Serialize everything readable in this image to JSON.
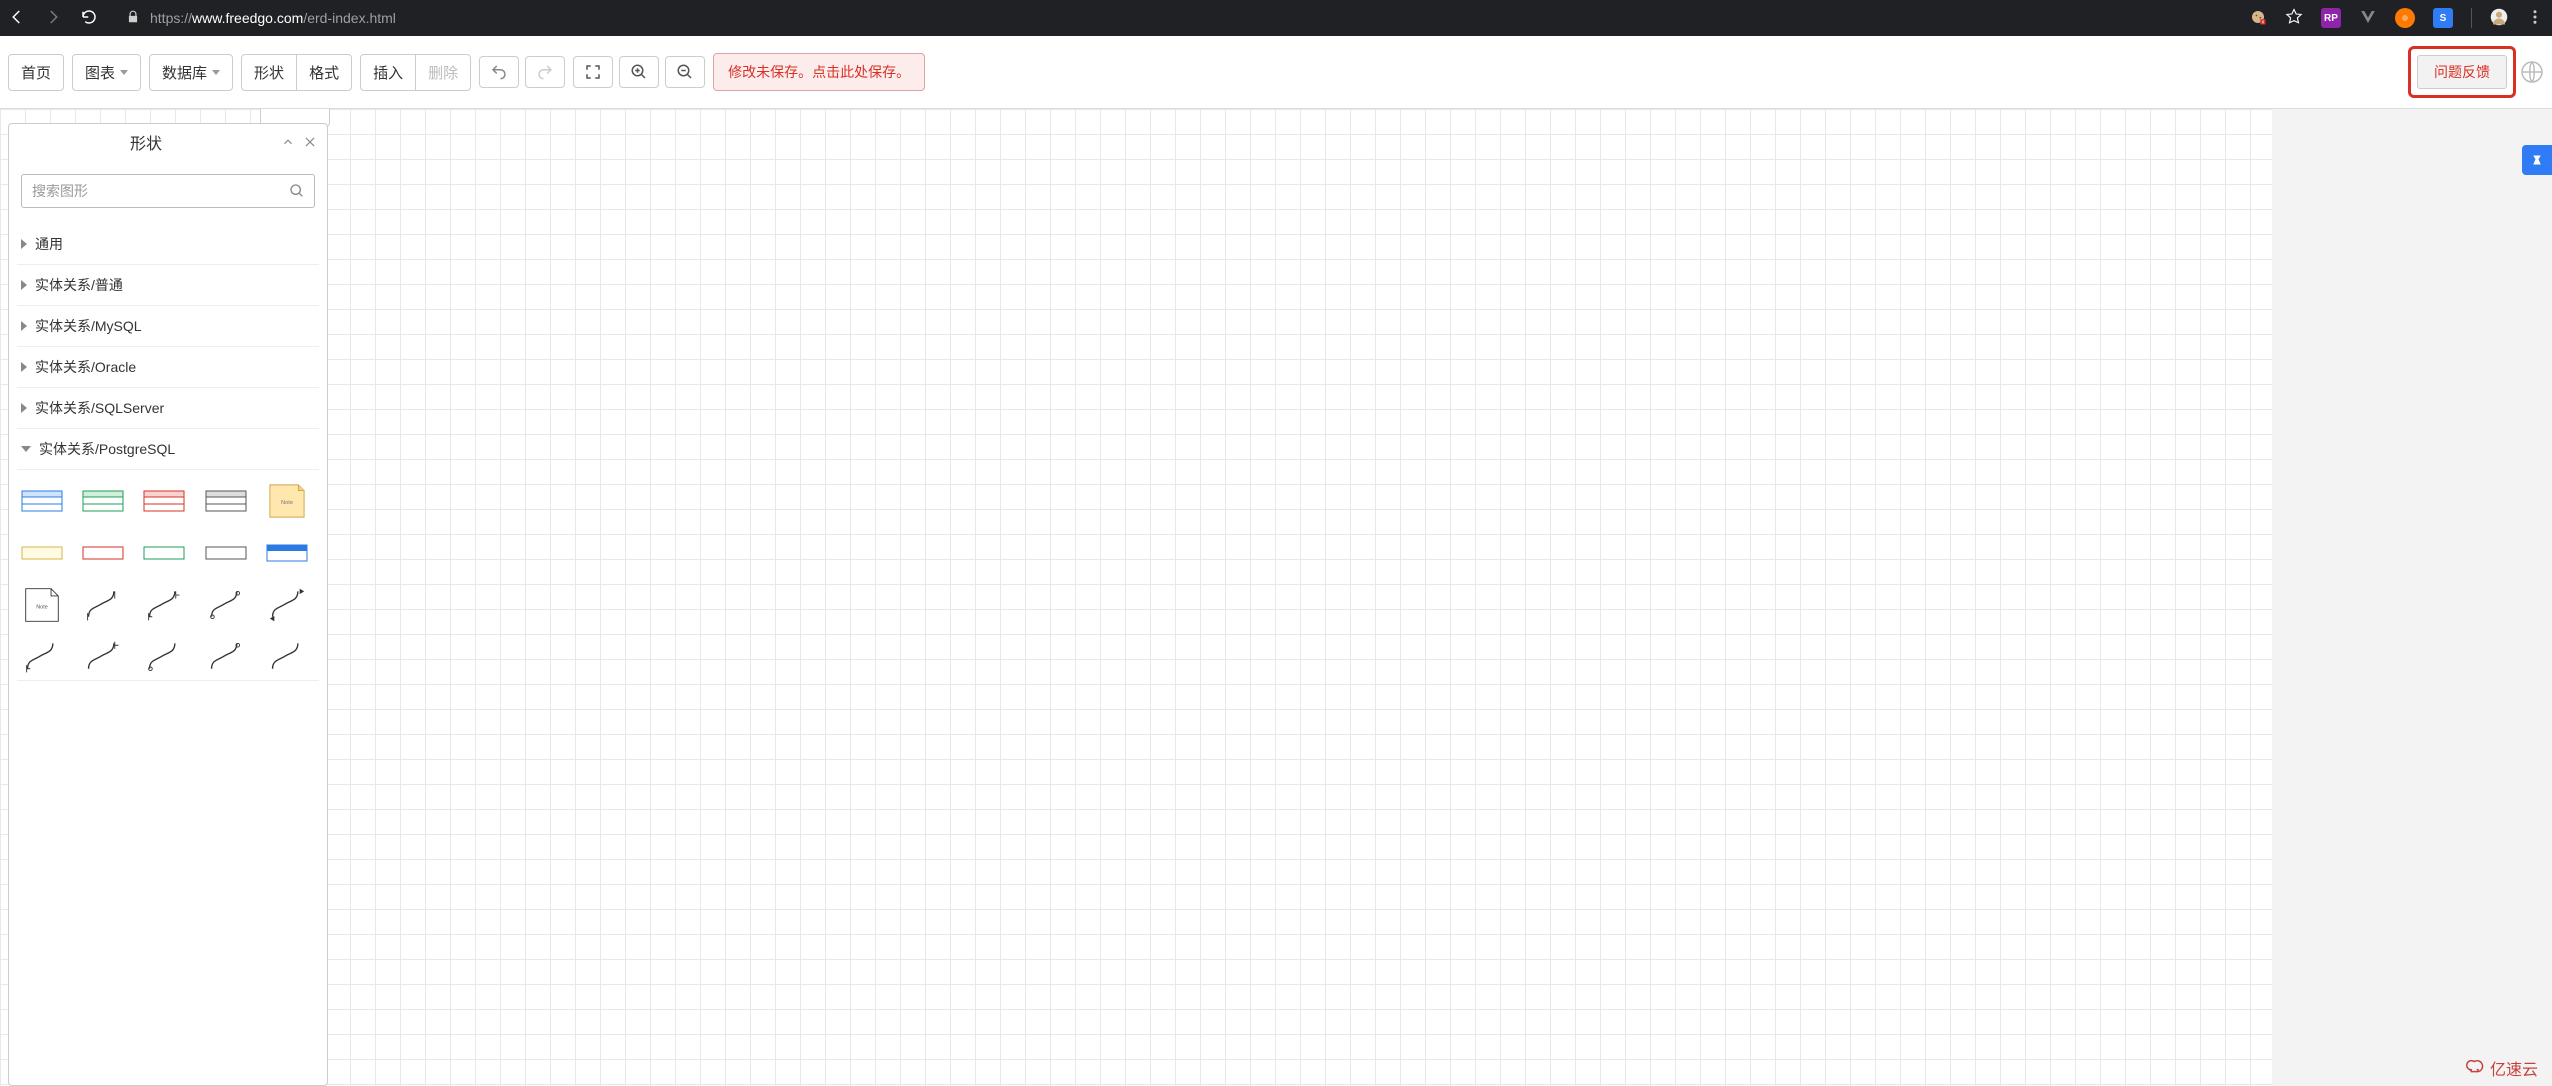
{
  "browser": {
    "url_prefix": "https://",
    "url_host": "www.freedgo.com",
    "url_path": "/erd-index.html"
  },
  "toolbar": {
    "home": "首页",
    "chart": "图表",
    "database": "数据库",
    "shape": "形状",
    "format": "格式",
    "insert": "插入",
    "delete": "删除",
    "save_banner": "修改未保存。点击此处保存。",
    "feedback": "问题反馈"
  },
  "panel": {
    "title": "形状",
    "search_placeholder": "搜索图形",
    "categories": [
      {
        "label": "通用",
        "open": false
      },
      {
        "label": "实体关系/普通",
        "open": false
      },
      {
        "label": "实体关系/MySQL",
        "open": false
      },
      {
        "label": "实体关系/Oracle",
        "open": false
      },
      {
        "label": "实体关系/SQLServer",
        "open": false
      },
      {
        "label": "实体关系/PostgreSQL",
        "open": true
      }
    ],
    "shapes_note": "Note"
  },
  "side_widget": {
    "label": "S"
  },
  "watermark": "亿速云"
}
